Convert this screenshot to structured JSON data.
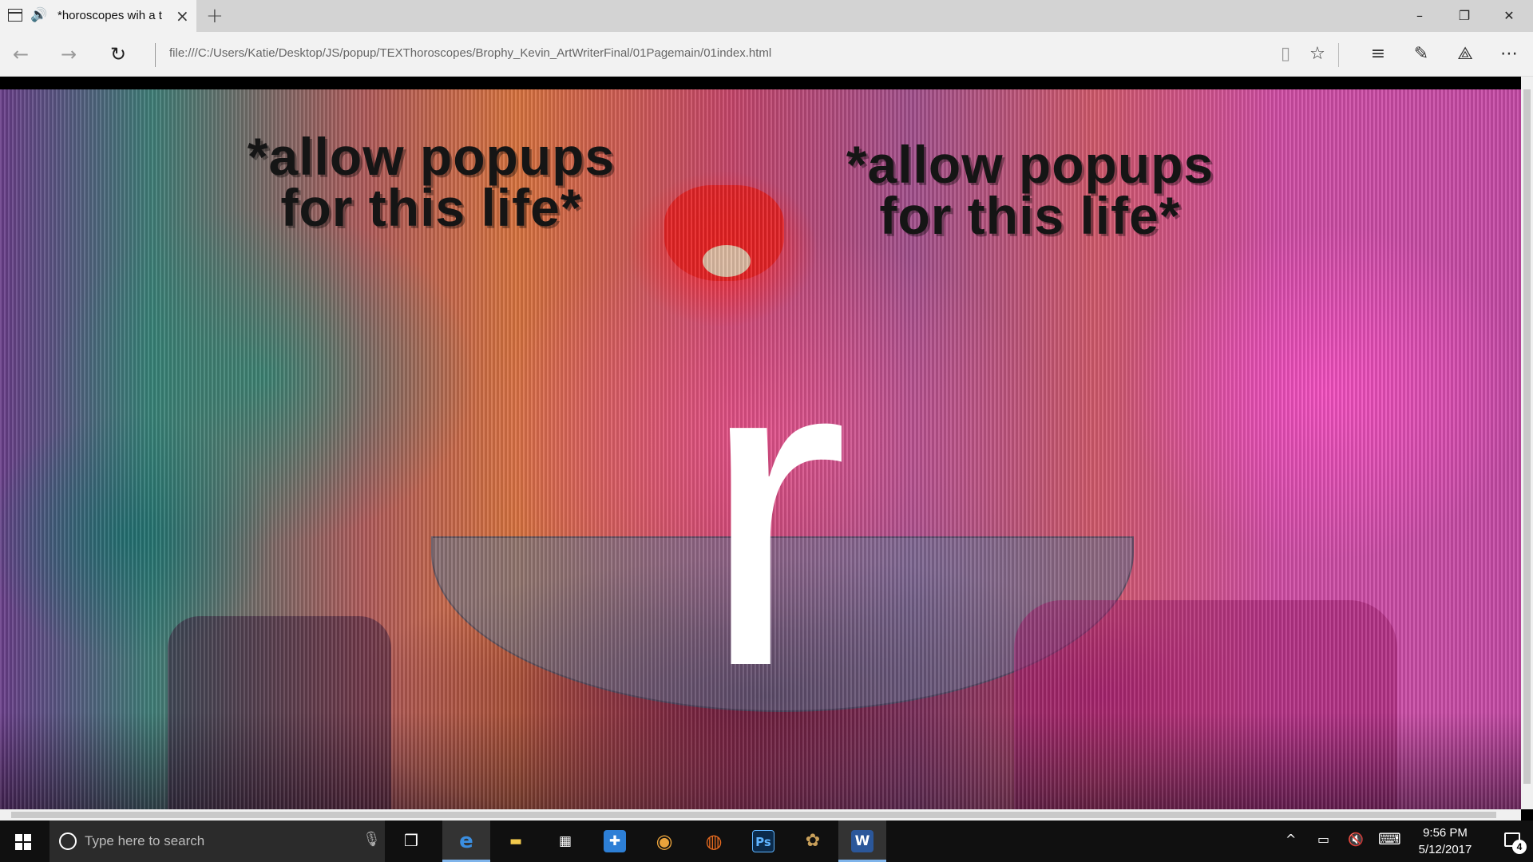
{
  "browser": {
    "tab": {
      "title": "*horoscopes wih a t",
      "close_glyph": "×",
      "audio_icon": "speaker-icon"
    },
    "new_tab_glyph": "+",
    "window_controls": {
      "minimize": "–",
      "restore": "❐",
      "close": "✕"
    },
    "nav": {
      "back": "←",
      "forward": "→",
      "refresh": "↻"
    },
    "address": "file:///C:/Users/Katie/Desktop/JS/popup/TEXThoroscopes/Brophy_Kevin_ArtWriterFinal/01Pagemain/01index.html",
    "toolbar": {
      "reading_view": "▯",
      "favorite": "☆",
      "hub": "≡",
      "web_note": "✎",
      "share": "⟁",
      "more": "⋯"
    }
  },
  "page": {
    "note_left": {
      "line1": "*allow popups",
      "line2": "for this life*"
    },
    "note_right": {
      "line1": "*allow popups",
      "line2": "for this life*"
    },
    "big_letter": "r",
    "colors": {
      "text_dark": "#151515",
      "letter": "#ffffff",
      "lamp": "#e61e1e",
      "magenta": "#d24ea6",
      "teal": "#3f7f78"
    }
  },
  "taskbar": {
    "search_placeholder": "Type here to search",
    "mic_glyph": "🎙",
    "task_view_glyph": "❒",
    "apps": [
      {
        "name": "edge",
        "glyph": "e",
        "color": "#3b8ee0"
      },
      {
        "name": "file-explorer",
        "glyph": "▬",
        "color": "#f2c94c"
      },
      {
        "name": "store",
        "glyph": "▦",
        "color": "#ffffff"
      },
      {
        "name": "defender",
        "glyph": "✚",
        "color": "#2d7fd6"
      },
      {
        "name": "chrome",
        "glyph": "◉",
        "color": "#e9a23b"
      },
      {
        "name": "firefox",
        "glyph": "◍",
        "color": "#e66a1f"
      },
      {
        "name": "photoshop",
        "glyph": "Ps",
        "color": "#2f6fcf"
      },
      {
        "name": "paint-app",
        "glyph": "✿",
        "color": "#c9a05a"
      },
      {
        "name": "word",
        "glyph": "W",
        "color": "#2b579a"
      }
    ],
    "tray": {
      "chevron": "^",
      "battery": "▭",
      "volume": "🔇",
      "keyboard": "⌨"
    },
    "clock": {
      "time": "9:56 PM",
      "date": "5/12/2017"
    },
    "notifications": "4"
  }
}
